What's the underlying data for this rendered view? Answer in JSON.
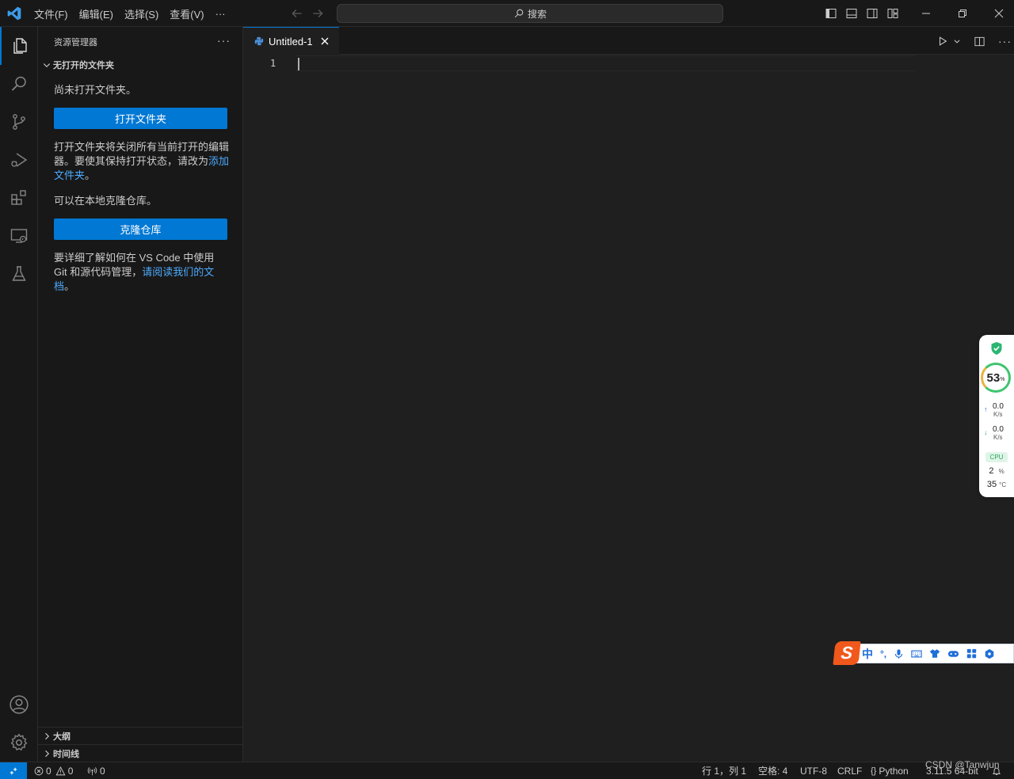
{
  "titlebar": {
    "menus": [
      "文件(F)",
      "编辑(E)",
      "选择(S)",
      "查看(V)",
      "···"
    ],
    "search_label": "搜索"
  },
  "sidebar": {
    "title": "资源管理器",
    "section_title": "无打开的文件夹",
    "no_folder_text": "尚未打开文件夹。",
    "open_folder_button": "打开文件夹",
    "open_folder_desc": "打开文件夹将关闭所有当前打开的编辑器。要使其保持打开状态，请改为",
    "add_folder_link": "添加文件夹",
    "period": "。",
    "clone_text": "可以在本地克隆仓库。",
    "clone_button": "克隆仓库",
    "git_desc": "要详细了解如何在 VS Code 中使用 Git 和源代码管理，",
    "docs_link": "请阅读我们的文档",
    "outline": "大纲",
    "timeline": "时间线"
  },
  "editor": {
    "tab_label": "Untitled-1",
    "line_number": "1"
  },
  "statusbar": {
    "errors": "0",
    "warnings": "0",
    "ports": "0",
    "position": "行 1，列 1",
    "spaces": "空格: 4",
    "encoding": "UTF-8",
    "eol": "CRLF",
    "language": "Python",
    "interpreter": "3.11.5 64-bit"
  },
  "monitor": {
    "percent": "53",
    "percent_unit": "%",
    "upload": "0.0",
    "upload_unit": "K/s",
    "download": "0.0",
    "download_unit": "K/s",
    "cpu_label": "CPU",
    "cpu_usage": "2",
    "cpu_usage_unit": "%",
    "cpu_temp": "35",
    "cpu_temp_unit": "°C"
  },
  "ime": {
    "logo": "S",
    "mode": "中",
    "punct": "°,"
  },
  "watermark": "CSDN @Tanwjun",
  "colors": {
    "accent": "#0078d4",
    "link": "#4daafc",
    "background": "#1f1f1f",
    "panel": "#181818"
  }
}
